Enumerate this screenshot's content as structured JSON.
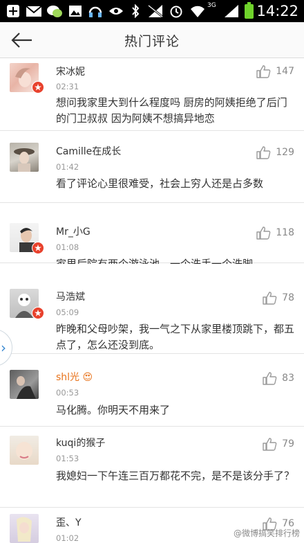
{
  "status_bar": {
    "time": "14:22",
    "network": "3G",
    "icons": [
      "add-icon",
      "mail-icon",
      "chat-app-icon",
      "image-icon",
      "headset-icon",
      "eye-icon",
      "bluetooth-icon",
      "signal-off-icon",
      "alarm-icon",
      "wifi-icon",
      "cell-signal-icon",
      "battery-icon"
    ],
    "battery_color": "#6fd22b"
  },
  "header": {
    "title": "热门评论",
    "back_icon": "arrow-left-icon"
  },
  "comments": [
    {
      "user": "宋冰妮",
      "time": "02:31",
      "likes": "147",
      "verified": true,
      "text": "想问我家里大到什么程度吗 厨房的阿姨拒绝了后门的门卫叔叔  因为阿姨不想搞异地恋"
    },
    {
      "user": "Camille在成长",
      "time": "01:42",
      "likes": "129",
      "verified": false,
      "text": "看了评论心里很难受，社会上穷人还是占多数"
    },
    {
      "user": "Mr_小G",
      "time": "01:08",
      "likes": "118",
      "verified": true,
      "text": "家里后院有两个游泳池，一个洗手一个洗脚"
    },
    {
      "user": "马浩斌",
      "time": "05:09",
      "likes": "78",
      "verified": true,
      "text": "昨晚和父母吵架，我一气之下从家里楼顶跳下，都五点了，怎么还没到底。"
    },
    {
      "user": "shl光",
      "time": "00:53",
      "likes": "83",
      "verified": false,
      "emoji": "😍",
      "text": "马化腾。你明天不用来了"
    },
    {
      "user": "kuqi的猴子",
      "time": "01:53",
      "likes": "79",
      "verified": false,
      "text": "我媳妇一下午连三百万都花不完，是不是该分手了？"
    },
    {
      "user": "歪、Y",
      "time": "01:02",
      "likes": "76",
      "verified": false,
      "text": ""
    }
  ],
  "side_handle": "›",
  "watermark": "@微博搞笑排行榜",
  "colors": {
    "accent_orange": "#e8731c",
    "verified_red": "#e8412c",
    "handle_blue": "#3b8ad1"
  }
}
